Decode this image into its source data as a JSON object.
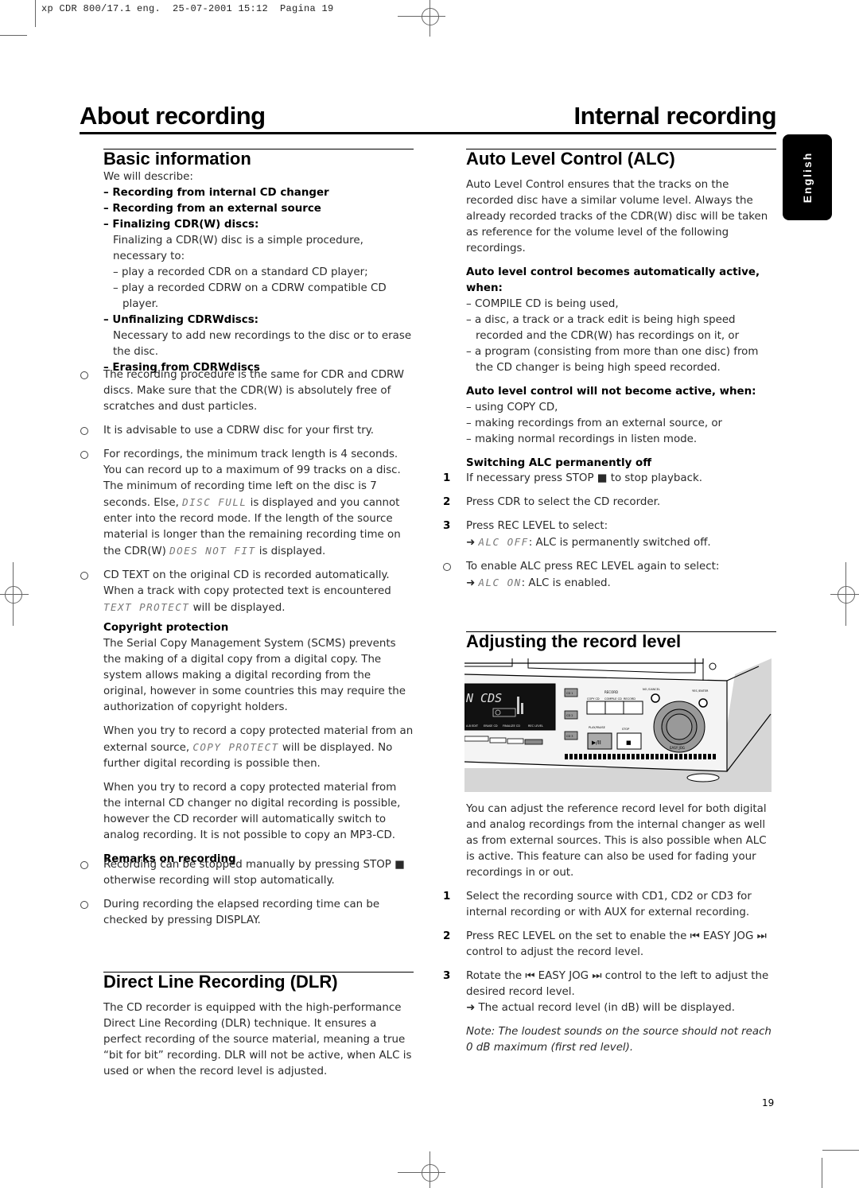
{
  "slug": "xp CDR 800/17.1 eng.  25-07-2001 15:12  Pagina 19",
  "header": {
    "left_title": "About recording",
    "right_title": "Internal recording"
  },
  "language_tab": "English",
  "page_number": "19",
  "left": {
    "basic": {
      "heading": "Basic information",
      "intro": "We will describe:",
      "items": [
        "– Recording from internal CD changer",
        "– Recording from an external source",
        "– Finalizing CDR(W) discs:"
      ],
      "finalizing_text": "Finalizing a CDR(W) disc is a simple procedure, necessary to:",
      "finalizing_list": [
        "– play a recorded CDR on a standard CD player;",
        "– play a recorded CDRW on a CDRW compatible CD player."
      ],
      "unfinalizing_label": "– Unfinalizing CDRWdiscs:",
      "unfinalizing_text": "Necessary to add new recordings to the disc or to erase the disc.",
      "erasing_label": "– Erasing from CDRWdiscs"
    },
    "bullets": {
      "b1": "The recording procedure is the same for CDR and CDRW discs. Make sure that the CDR(W) is absolutely free of scratches and dust particles.",
      "b2": "It is advisable to use a CDRW disc for your first try.",
      "b3_pre": "For recordings, the minimum track length is 4 seconds. You can record up to a maximum of 99 tracks on a disc. The minimum of recording time left on the disc is 7 seconds. Else, ",
      "b3_lcd1": "DISC FULL",
      "b3_mid": " is displayed and you cannot enter into the record mode. If the length of the source material is longer than the remaining recording time on the CDR(W) ",
      "b3_lcd2": "DOES NOT FIT",
      "b3_post": " is displayed.",
      "b4_pre": "CD TEXT on the original CD is recorded automatically. When a track with copy protected text is encountered ",
      "b4_lcd": "TEXT PROTECT",
      "b4_post": " will be displayed."
    },
    "copyright": {
      "heading": "Copyright protection",
      "p1": "The Serial Copy Management System (SCMS) prevents the making of a digital copy from a digital copy. The system allows making a digital recording from the original, however in some countries this may require the authorization of copyright holders.",
      "p2_pre": "When you try to record a copy protected material from an external source, ",
      "p2_lcd": "COPY PROTECT",
      "p2_post": " will be displayed. No further digital recording is possible then.",
      "p3": "When you try to record a copy protected material from the internal CD changer no digital recording is possible, however the CD recorder will automatically switch to analog recording. It is not possible to copy an MP3-CD."
    },
    "remarks": {
      "heading": "Remarks on recording",
      "r1": "Recording can be stopped manually by pressing STOP ■ otherwise recording will stop automatically.",
      "r2": "During recording the elapsed recording time can be checked by pressing DISPLAY."
    },
    "dlr": {
      "heading": "Direct Line Recording (DLR)",
      "text": "The CD recorder is equipped with the high-performance Direct Line Recording (DLR) technique. It ensures a perfect recording of the source material, meaning a true “bit for bit” recording. DLR will not be active, when ALC is used or when the record level is adjusted."
    }
  },
  "right": {
    "alc": {
      "heading": "Auto Level Control (ALC)",
      "intro": "Auto Level Control ensures that the tracks on the recorded disc have a similar volume level. Always the already recorded tracks of the CDR(W) disc will be taken as reference for the volume level of the following recordings.",
      "active_heading": "Auto level control becomes automatically active, when:",
      "active_list": [
        "– COMPILE CD is being used,",
        "– a disc, a track or a track edit is being high speed recorded and the CDR(W) has recordings on it, or",
        "– a program (consisting from more than one disc) from the CD changer is being high speed recorded."
      ],
      "inactive_heading": "Auto level control will not become active, when:",
      "inactive_list": [
        "– using COPY CD,",
        "– making recordings from an external source, or",
        "– making normal recordings in listen mode."
      ],
      "switch_heading": "Switching ALC permanently off",
      "steps": [
        {
          "num": "1",
          "text": "If necessary press STOP ■ to stop playback."
        },
        {
          "num": "2",
          "text": "Press CDR to select the CD recorder."
        },
        {
          "num": "3",
          "text": "Press REC LEVEL to select:"
        }
      ],
      "step3_arrow": "➜",
      "step3_lcd": "ALC OFF",
      "step3_result": ": ALC is permanently switched off.",
      "enable_text": "To enable ALC press REC LEVEL again to select:",
      "enable_lcd": "ALC ON",
      "enable_result": ": ALC is enabled."
    },
    "adjust": {
      "heading": "Adjusting the record level",
      "intro": "You can adjust the reference record level for both digital and analog recordings from the internal changer as well as from external sources. This is also possible when ALC is active. This feature can also be used for fading your recordings in or out.",
      "steps": [
        {
          "num": "1",
          "text": "Select the recording source with CD1, CD2 or CD3 for internal recording or with AUX for external recording."
        },
        {
          "num": "2",
          "text": "Press REC LEVEL on the set to enable the ⏮ EASY JOG ⏭ control to adjust the record level."
        },
        {
          "num": "3",
          "text": "Rotate the ⏮ EASY JOG ⏭ control to the left to adjust the desired record level."
        }
      ],
      "step3_result": "➜ The actual record level (in dB) will be displayed.",
      "note": "Note: The loudest sounds on the source should not reach 0 dB maximum (first red level)."
    },
    "device": {
      "display_text": "N CDS",
      "buttons_under_display": [
        "A-B EDIT",
        "ERASE CD",
        "FINALIZE CD",
        "REC LEVEL"
      ],
      "cd_buttons": [
        "CD 1",
        "CD 2",
        "CD 3"
      ],
      "record_label": "RECORD",
      "record_buttons": [
        "COPY CD",
        "COMPILE CD",
        "RECORD"
      ],
      "play_label": "PLAY/PAUSE",
      "stop_label": "STOP",
      "play_symbol": "▶/II",
      "stop_symbol": "■",
      "no_cancel": "NO /CANCEL",
      "yes_enter": "YES /ENTER",
      "jog_label": "EASY JOG"
    }
  }
}
